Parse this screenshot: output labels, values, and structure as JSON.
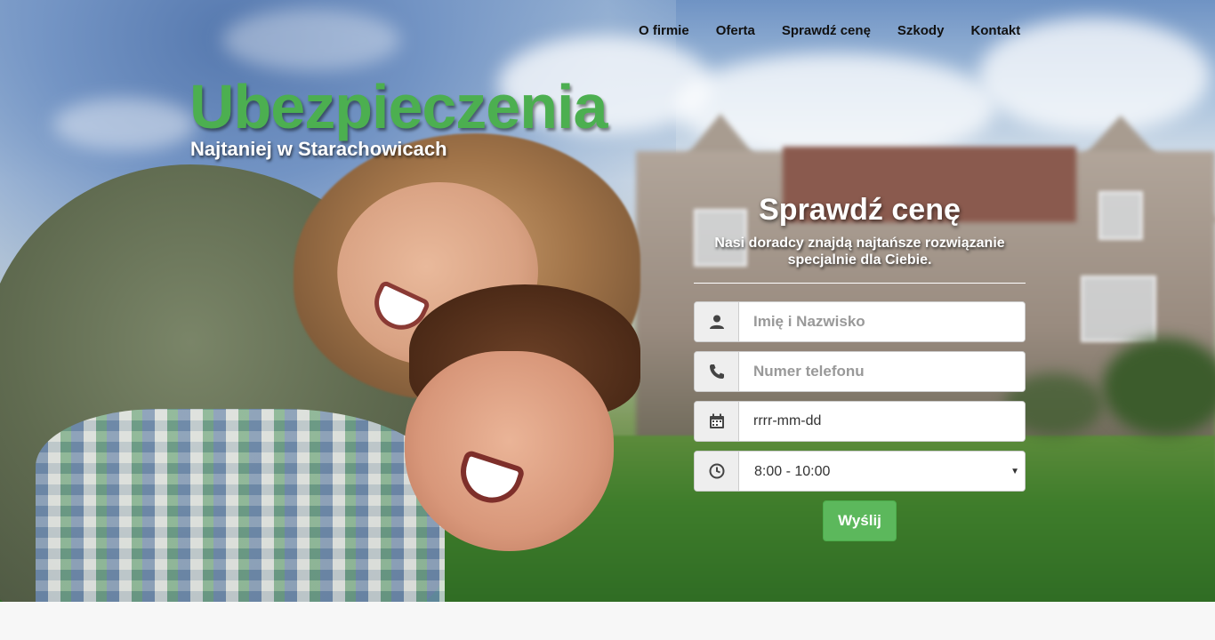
{
  "nav": {
    "items": [
      {
        "label": "O firmie"
      },
      {
        "label": "Oferta"
      },
      {
        "label": "Sprawdź cenę"
      },
      {
        "label": "Szkody"
      },
      {
        "label": "Kontakt"
      }
    ]
  },
  "brand": {
    "title": "Ubezpieczenia",
    "subtitle": "Najtaniej w Starachowicach",
    "accent_color": "#4caf50"
  },
  "form": {
    "title": "Sprawdź cenę",
    "description": "Nasi doradcy znajdą najtańsze rozwiązanie specjalnie dla Ciebie.",
    "name_placeholder": "Imię i Nazwisko",
    "phone_placeholder": "Numer telefonu",
    "date_value": "rrrr-mm-dd",
    "time_selected": "8:00 - 10:00",
    "submit_label": "Wyślij",
    "submit_color": "#5cb85c",
    "icons": {
      "name": "user-icon",
      "phone": "phone-icon",
      "date": "calendar-icon",
      "time": "clock-icon"
    }
  }
}
